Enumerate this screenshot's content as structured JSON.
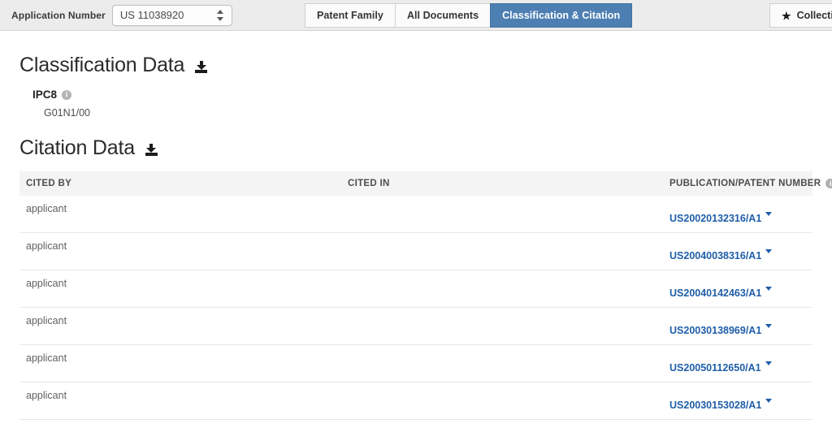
{
  "toolbar": {
    "application_number_label": "Application Number",
    "application_number_value": "US 11038920",
    "tabs": [
      {
        "label": "Patent Family",
        "active": false
      },
      {
        "label": "All Documents",
        "active": false
      },
      {
        "label": "Classification & Citation",
        "active": true
      }
    ],
    "collection_button_label": "Collection",
    "star_icon": "star-icon",
    "active_tab_color": "#4d7fb3"
  },
  "classification": {
    "title": "Classification Data",
    "download_icon": "download-icon",
    "scheme_label": "IPC8",
    "info_icon": "info-icon",
    "codes": [
      "G01N1/00"
    ]
  },
  "citation": {
    "title": "Citation Data",
    "download_icon": "download-icon",
    "columns": [
      {
        "label": "CITED BY",
        "info": false
      },
      {
        "label": "CITED IN",
        "info": false
      },
      {
        "label": "PUBLICATION/PATENT NUMBER",
        "info": true
      }
    ],
    "rows": [
      {
        "cited_by": "applicant",
        "cited_in": "",
        "publication_number": "US20020132316/A1"
      },
      {
        "cited_by": "applicant",
        "cited_in": "",
        "publication_number": "US20040038316/A1"
      },
      {
        "cited_by": "applicant",
        "cited_in": "",
        "publication_number": "US20040142463/A1"
      },
      {
        "cited_by": "applicant",
        "cited_in": "",
        "publication_number": "US20030138969/A1"
      },
      {
        "cited_by": "applicant",
        "cited_in": "",
        "publication_number": "US20050112650/A1"
      },
      {
        "cited_by": "applicant",
        "cited_in": "",
        "publication_number": "US20030153028/A1"
      }
    ],
    "link_color": "#1f5ea8"
  }
}
